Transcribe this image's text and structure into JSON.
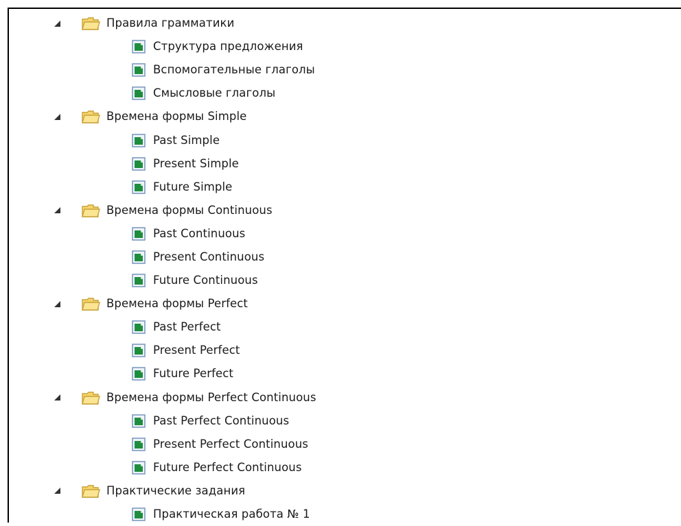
{
  "tree": [
    {
      "label": "Правила грамматики",
      "icon": "folder-icon",
      "expanded": true,
      "children": [
        "Структура предложения",
        "Вспомогательные глаголы",
        "Смысловые глаголы"
      ]
    },
    {
      "label": "Времена формы Simple",
      "icon": "folder-icon",
      "expanded": true,
      "children": [
        "Past Simple",
        "Present Simple",
        "Future Simple"
      ]
    },
    {
      "label": "Времена формы Continuous",
      "icon": "folder-icon",
      "expanded": true,
      "children": [
        "Past Continuous",
        "Present Continuous",
        "Future Continuous"
      ]
    },
    {
      "label": "Времена формы Perfect",
      "icon": "folder-icon",
      "expanded": true,
      "children": [
        "Past Perfect",
        "Present Perfect",
        "Future Perfect"
      ]
    },
    {
      "label": "Времена формы Perfect Continuous",
      "icon": "folder-icon",
      "expanded": true,
      "children": [
        "Past Perfect Continuous",
        "Present Perfect Continuous",
        "Future Perfect Continuous"
      ]
    },
    {
      "label": "Практические задания",
      "icon": "folder-icon",
      "expanded": true,
      "children": [
        "Практическая работа № 1"
      ]
    }
  ],
  "colors": {
    "folder_fill": "#f6d56a",
    "folder_stroke": "#c8a23a",
    "page_fill": "#1f8d3e",
    "page_frame": "#6d8fb8",
    "expander": "#333333"
  }
}
